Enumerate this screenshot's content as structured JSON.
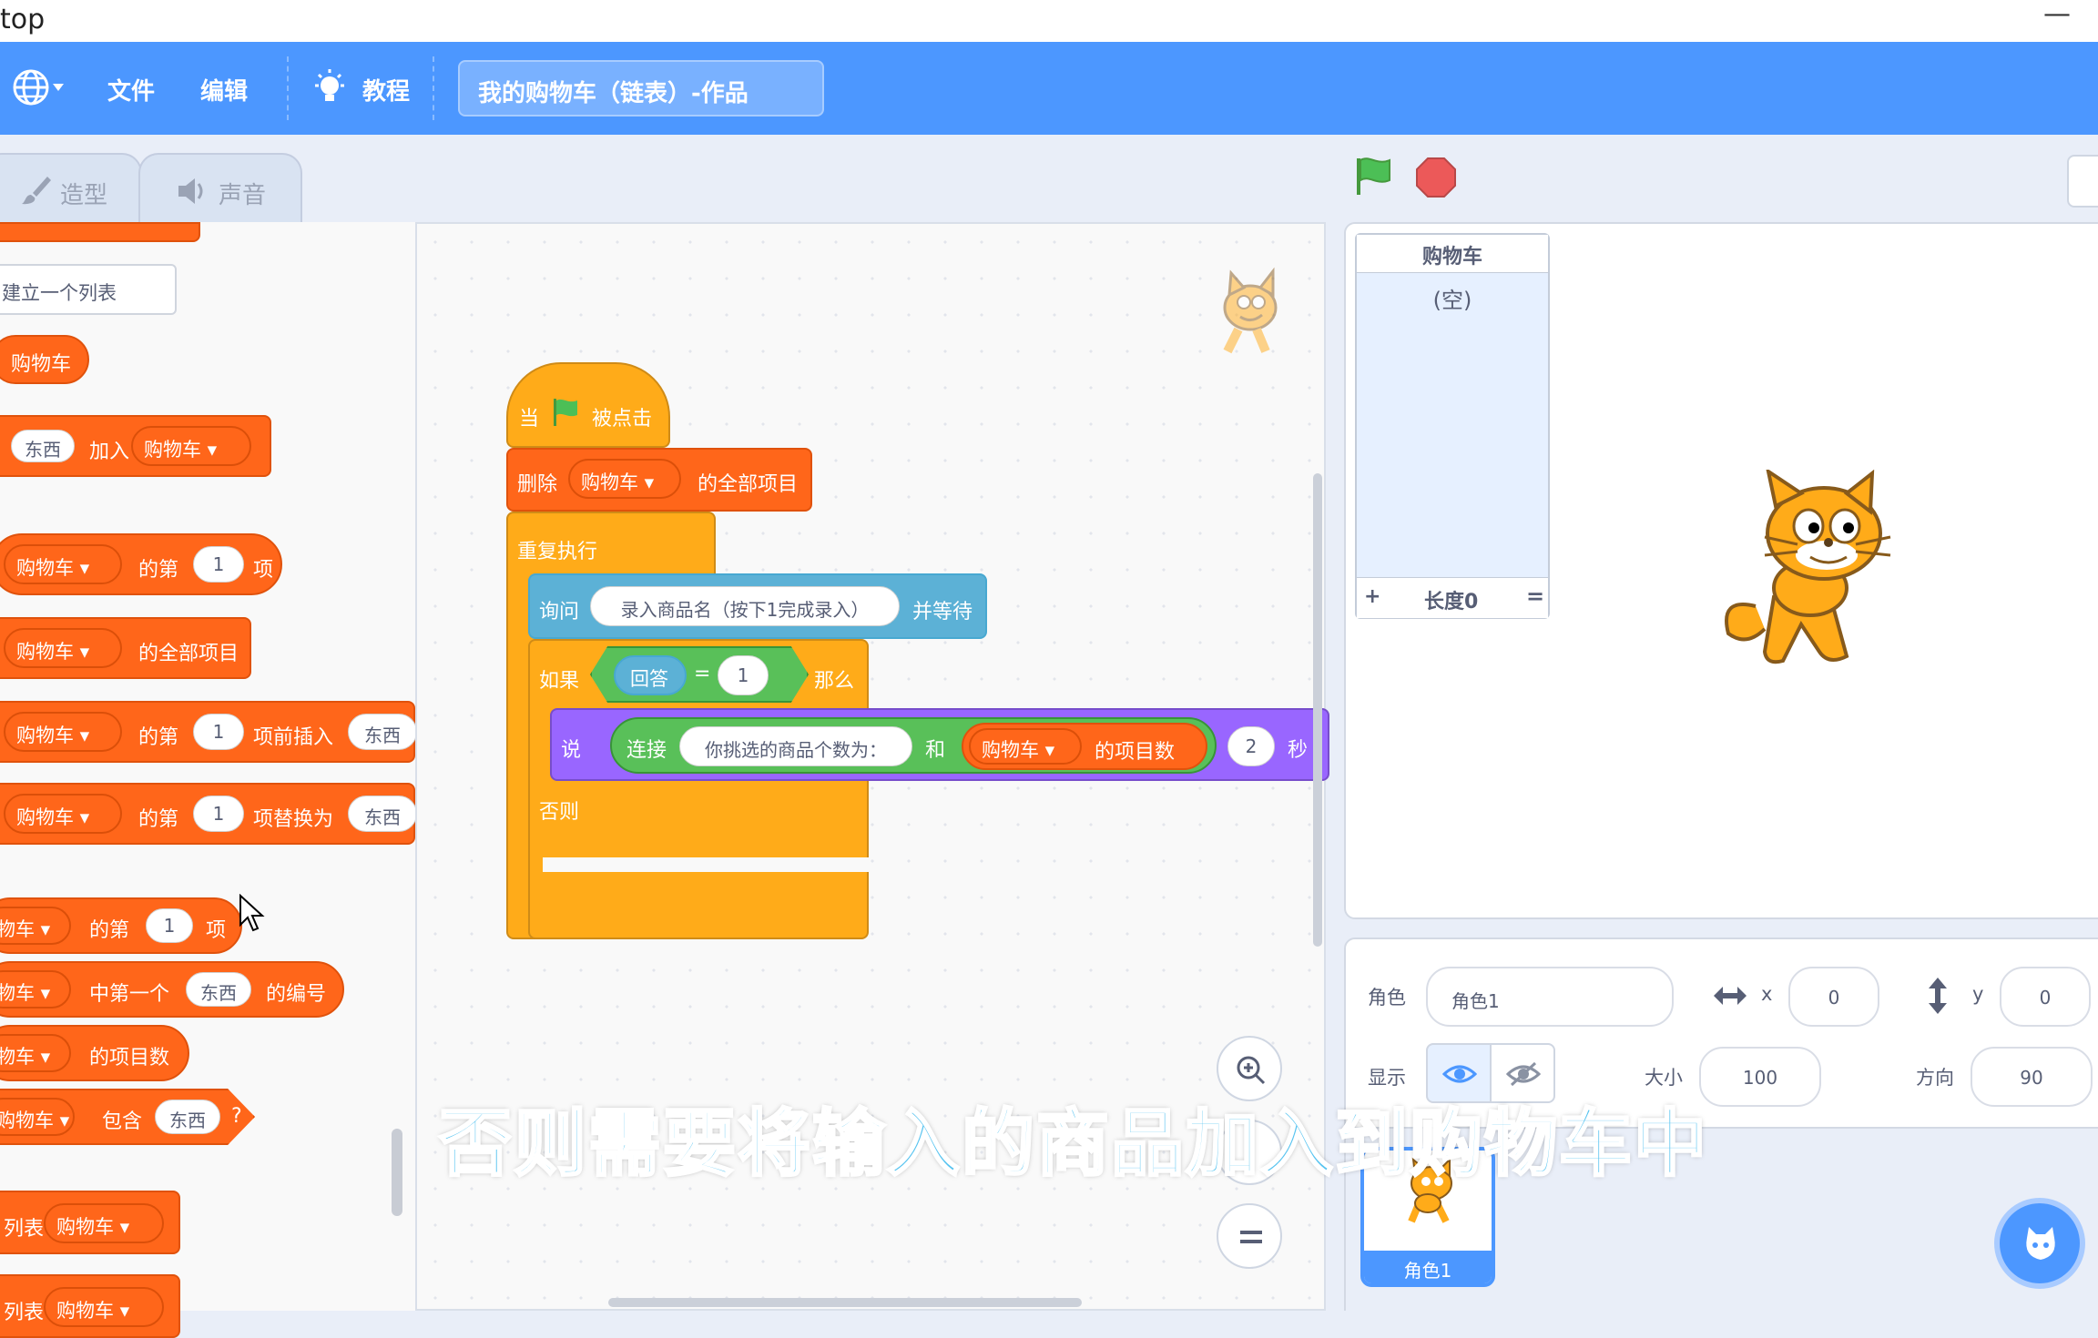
{
  "window": {
    "title_fragment": "top",
    "minimize_glyph": "—"
  },
  "menubar": {
    "file": "文件",
    "edit": "编辑",
    "tutorials": "教程",
    "project_title": "我的购物车（链表）-作品",
    "icons": [
      "globe-icon",
      "bulb-icon"
    ]
  },
  "tabs": {
    "costumes": "造型",
    "sounds": "声音"
  },
  "palette": {
    "make_list": "建立一个列表",
    "list_reporter": "购物车",
    "add_block": {
      "item": "东西",
      "verb": "加入",
      "list": "购物车"
    },
    "item_of": {
      "list": "购物车",
      "of": "的第",
      "index": "1",
      "suffix": "项"
    },
    "delete_all": {
      "list": "购物车",
      "suffix": "的全部项目"
    },
    "insert_at": {
      "list": "购物车",
      "of": "的第",
      "index": "1",
      "suffix": "项前插入",
      "item": "东西"
    },
    "replace": {
      "list": "购物车",
      "of": "的第",
      "index": "1",
      "suffix": "项替换为",
      "item": "东西"
    },
    "item_of2": {
      "list": "物车",
      "of": "的第",
      "index": "1",
      "suffix": "项"
    },
    "index_of": {
      "list": "物车",
      "prefix": "中第一个",
      "item": "东西",
      "suffix": "的编号"
    },
    "length": {
      "list": "物车",
      "suffix": "的项目数"
    },
    "contains": {
      "list": "购物车",
      "prefix": "包含",
      "item": "东西",
      "suffix": "?"
    },
    "show_list": {
      "prefix": "列表",
      "list": "购物车"
    },
    "hide_list": {
      "prefix": "列表",
      "list": "购物车"
    }
  },
  "script": {
    "hat": {
      "when": "当",
      "clicked": "被点击"
    },
    "delete_all": {
      "prefix": "删除",
      "list": "购物车",
      "suffix": "的全部项目"
    },
    "forever": "重复执行",
    "ask": {
      "prefix": "询问",
      "question": "录入商品名（按下1完成录入）",
      "suffix": "并等待"
    },
    "if": {
      "prefix": "如果",
      "answer": "回答",
      "op": "=",
      "value": "1",
      "then": "那么"
    },
    "say": {
      "prefix": "说",
      "join": "连接",
      "text": "你挑选的商品个数为：",
      "and": "和",
      "list": "购物车",
      "length": "的项目数",
      "secs": "2",
      "unit": "秒"
    },
    "else": "否则"
  },
  "stage": {
    "monitor": {
      "title": "购物车",
      "empty": "(空)",
      "add": "+",
      "length": "长度0",
      "resize": "="
    }
  },
  "sprite_info": {
    "sprite_label": "角色",
    "sprite_name": "角色1",
    "x_label": "x",
    "x_value": "0",
    "y_label": "y",
    "y_value": "0",
    "show_label": "显示",
    "size_label": "大小",
    "size_value": "100",
    "direction_label": "方向",
    "direction_value": "90"
  },
  "sprite_list": {
    "thumb_name": "角色1"
  },
  "subtitle": "否则需要将输入的商品加入到购物车中",
  "colors": {
    "accent": "#4c97ff",
    "lists": "#ff661a",
    "control": "#ffab19",
    "sensing": "#5cb1d6",
    "looks": "#9966ff",
    "operators": "#59c059"
  }
}
